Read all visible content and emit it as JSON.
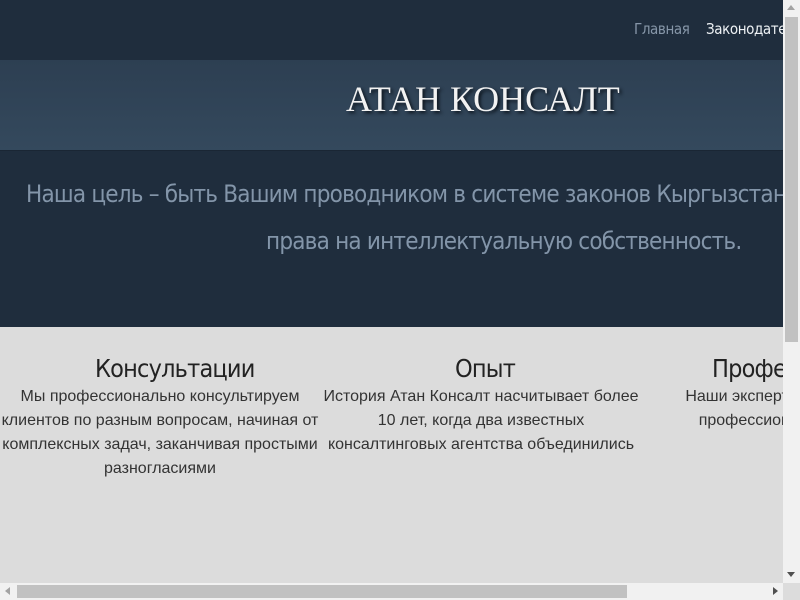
{
  "nav": {
    "items": [
      {
        "label": "Главная"
      },
      {
        "label": "Законодател"
      }
    ]
  },
  "header": {
    "title": "АТАН КОНСАЛТ"
  },
  "hero": {
    "line1": "Наша цель – быть Вашим проводником в системе законов Кыргызстана и з",
    "line2": "права на интеллектуальную собственность."
  },
  "features": [
    {
      "title": "Консультации",
      "text": "Мы профессионально консультируем клиентов по разным вопросам, начиная от комплексных задач, заканчивая простыми разногласиями"
    },
    {
      "title": "Опыт",
      "text": "История Атан Консалт насчитывает более 10 лет, когда два известных консалтинговых агентства объединились"
    },
    {
      "title": "Профес",
      "text": "Наши эксперты по вопросе, мы профессиональ подход к ка"
    }
  ],
  "colors": {
    "nav_bg": "#1f2d3d",
    "title_band_bg": "#34495d",
    "hero_text": "#8395a9",
    "body_bg": "#dcdcdc"
  }
}
